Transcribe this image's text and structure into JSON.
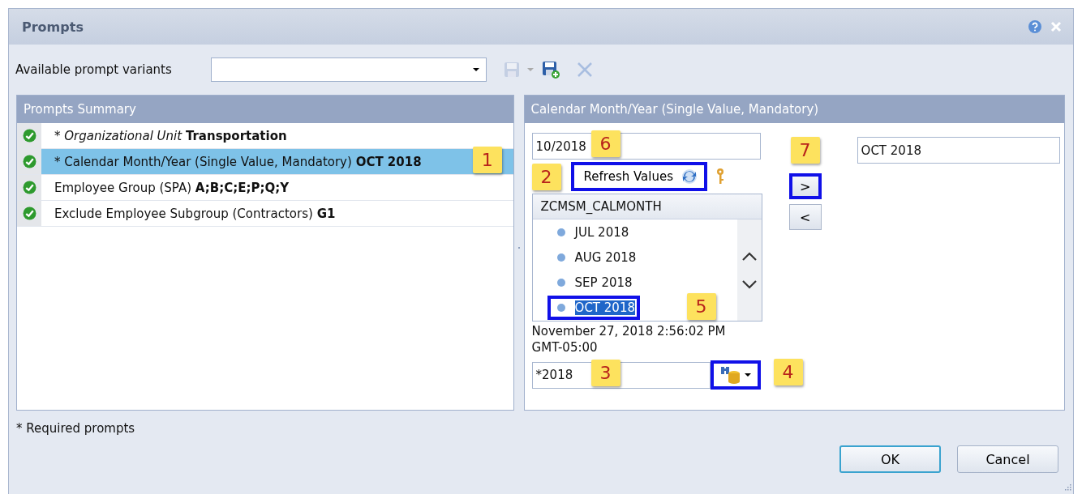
{
  "window": {
    "title": "Prompts"
  },
  "variants": {
    "label": "Available prompt variants",
    "tools": [
      {
        "kind": "save",
        "disabled": true
      },
      {
        "kind": "save_as",
        "disabled": false
      },
      {
        "kind": "delete",
        "disabled": true
      }
    ]
  },
  "summary": {
    "title": "Prompts Summary",
    "items": [
      {
        "label": "* *Organizational Unit*",
        "value": "Transportation",
        "valid": true,
        "selected": false
      },
      {
        "label": "* Calendar Month/Year (Single Value, Mandatory)",
        "value": "OCT 2018",
        "valid": true,
        "selected": true,
        "callout": "1"
      },
      {
        "label": "Employee Group (SPA)",
        "value": "A;B;C;E;P;Q;Y",
        "valid": true,
        "selected": false
      },
      {
        "label": "Exclude Employee Subgroup (Contractors)",
        "value": "G1",
        "valid": true,
        "selected": false
      }
    ]
  },
  "detail": {
    "title": "Calendar Month/Year (Single Value, Mandatory)",
    "input": {
      "value": "10/2018",
      "callout": "6"
    },
    "refresh": {
      "label": "Refresh Values",
      "highlighted": true,
      "callout": "2"
    },
    "list": {
      "column": "ZCMSM_CALMONTH",
      "items": [
        {
          "label": "JUL 2018",
          "selected": false,
          "highlighted": false
        },
        {
          "label": "AUG 2018",
          "selected": false,
          "highlighted": false
        },
        {
          "label": "SEP 2018",
          "selected": false,
          "highlighted": false
        },
        {
          "label": "OCT 2018",
          "selected": true,
          "highlighted": true,
          "callout": "5"
        }
      ]
    },
    "timestamp": "November 27, 2018 2:56:02 PM GMT-05:00",
    "search": {
      "value": "*2018",
      "callout": "3",
      "button_highlighted": true,
      "button_callout": "4"
    },
    "move": [
      {
        "label": ">",
        "highlighted": true,
        "callout": "7"
      },
      {
        "label": "<",
        "highlighted": false
      }
    ],
    "selected_value": "OCT 2018"
  },
  "footnote": "* Required prompts",
  "buttons": [
    {
      "label": "OK",
      "default": true
    },
    {
      "label": "Cancel",
      "default": false
    }
  ]
}
